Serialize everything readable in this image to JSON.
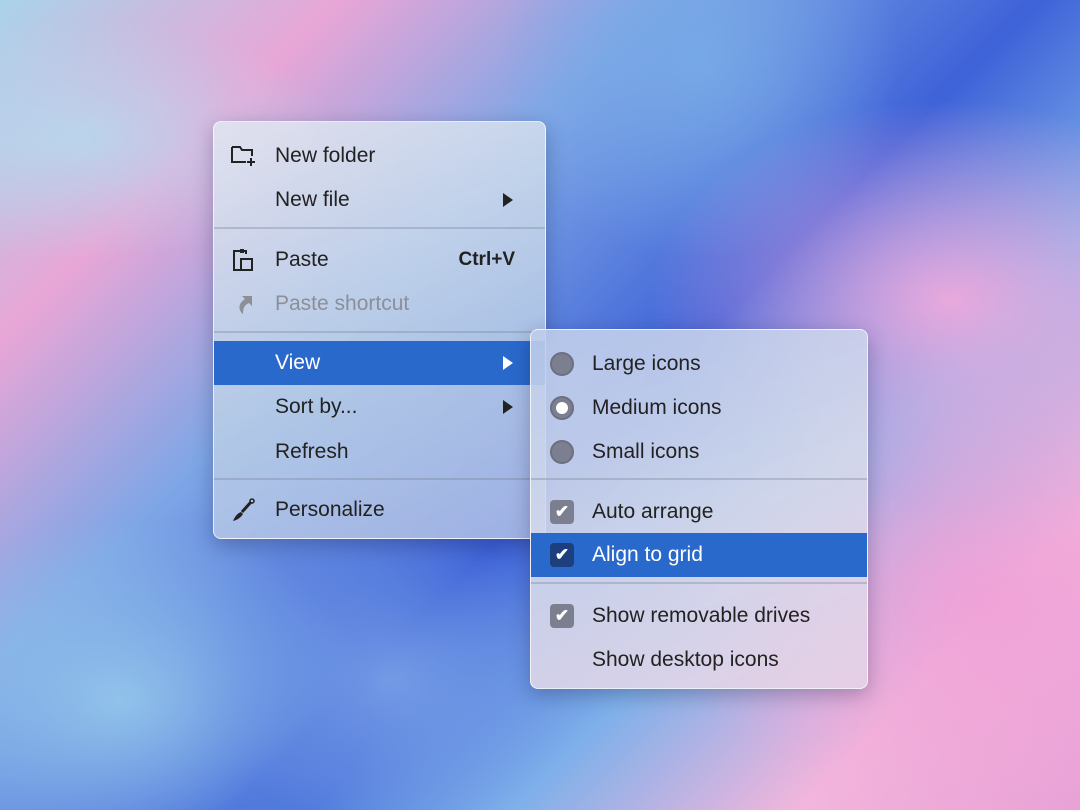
{
  "context_menu": {
    "items": [
      {
        "label": "New folder",
        "icon": "new-folder-icon"
      },
      {
        "label": "New file",
        "submenu": true
      },
      {
        "label": "Paste",
        "shortcut": "Ctrl+V",
        "icon": "paste-icon"
      },
      {
        "label": "Paste shortcut",
        "disabled": true,
        "icon": "shortcut-arrow-icon"
      },
      {
        "label": "View",
        "submenu": true,
        "highlighted": true
      },
      {
        "label": "Sort by...",
        "submenu": true
      },
      {
        "label": "Refresh"
      },
      {
        "label": "Personalize",
        "icon": "paintbrush-icon"
      }
    ]
  },
  "view_submenu": {
    "items": [
      {
        "label": "Large icons",
        "type": "radio",
        "checked": false
      },
      {
        "label": "Medium icons",
        "type": "radio",
        "checked": true
      },
      {
        "label": "Small icons",
        "type": "radio",
        "checked": false
      },
      {
        "label": "Auto arrange",
        "type": "checkbox",
        "checked": true
      },
      {
        "label": "Align to grid",
        "type": "checkbox",
        "checked": true,
        "highlighted": true
      },
      {
        "label": "Show removable drives",
        "type": "checkbox",
        "checked": true
      },
      {
        "label": "Show desktop icons",
        "type": "checkbox",
        "checked": false
      }
    ]
  },
  "check_glyph": "✔",
  "colors": {
    "highlight": "#2a69cc"
  }
}
